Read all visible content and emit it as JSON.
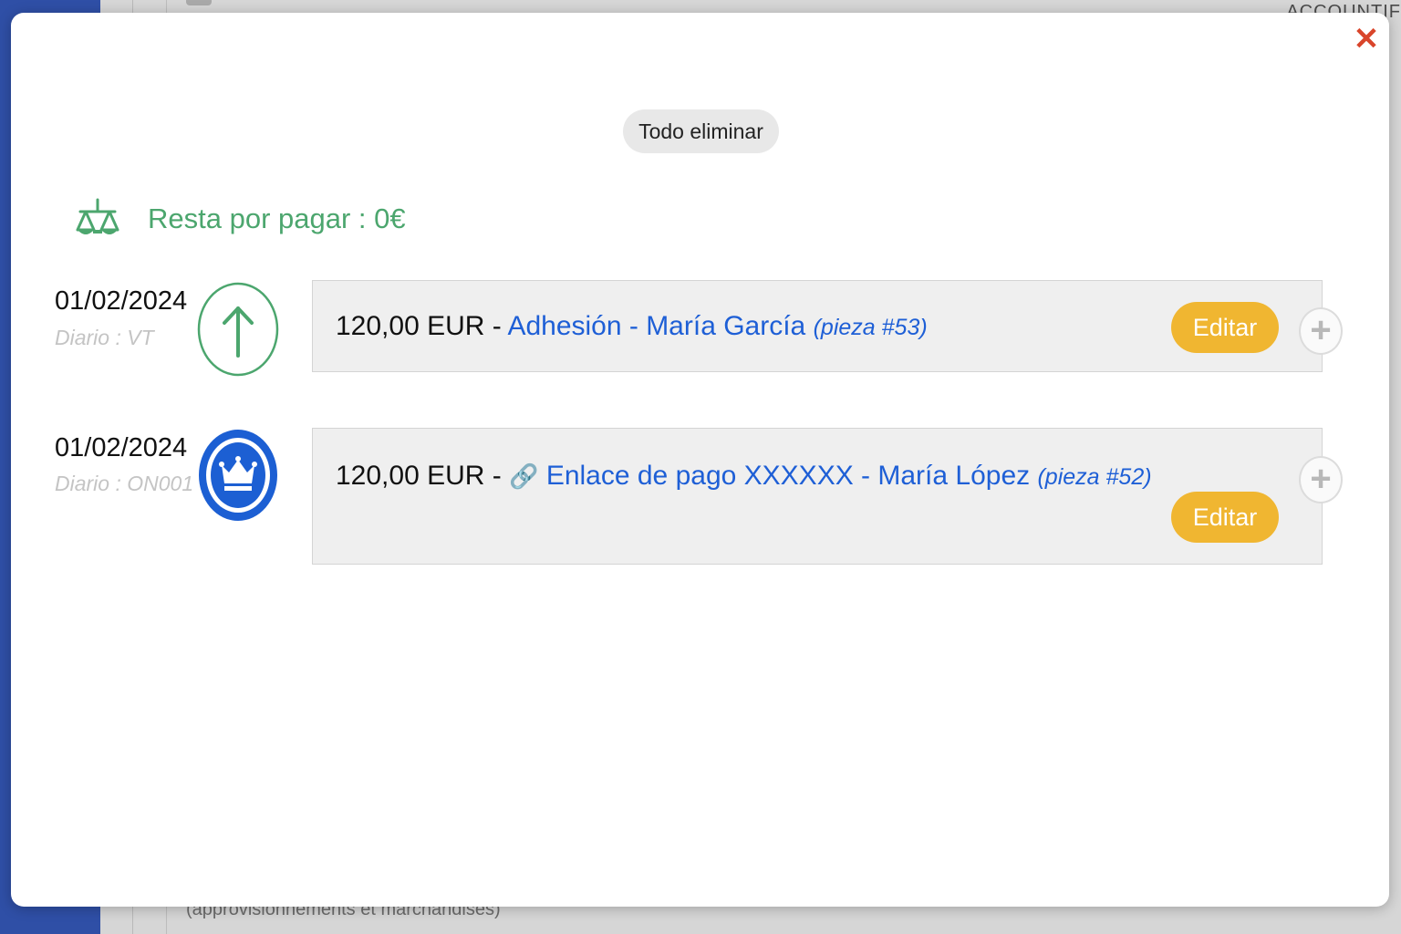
{
  "background": {
    "top_right_text": "ACCOUNTIF",
    "bottom_text": "(approvisionnements et marchandises)"
  },
  "modal": {
    "close_icon": "close-icon",
    "delete_all_label": "Todo eliminar",
    "balance": {
      "icon": "scale-icon",
      "text": "Resta por pagar : 0€",
      "color": "#4ca66e"
    },
    "entries": [
      {
        "date": "01/02/2024",
        "journal": "Diario : VT",
        "icon": "arrow-up-icon",
        "amount": "120,00 EUR - ",
        "link_text": "Adhesión - María García",
        "piece": "(pieza #53)",
        "edit_label": "Editar",
        "plus": "+"
      },
      {
        "date": "01/02/2024",
        "journal": "Diario : ON001",
        "icon": "crown-icon",
        "amount": "120,00 EUR - ",
        "chain_icon": "🔗",
        "link_text": "Enlace de pago XXXXXX - María López",
        "piece": "(pieza #52)",
        "edit_label": "Editar",
        "plus": "+"
      }
    ]
  },
  "colors": {
    "accent_yellow": "#f0b631",
    "link_blue": "#1e5fd6",
    "close_red": "#d9452b",
    "crown_blue": "#1c5fd3"
  }
}
